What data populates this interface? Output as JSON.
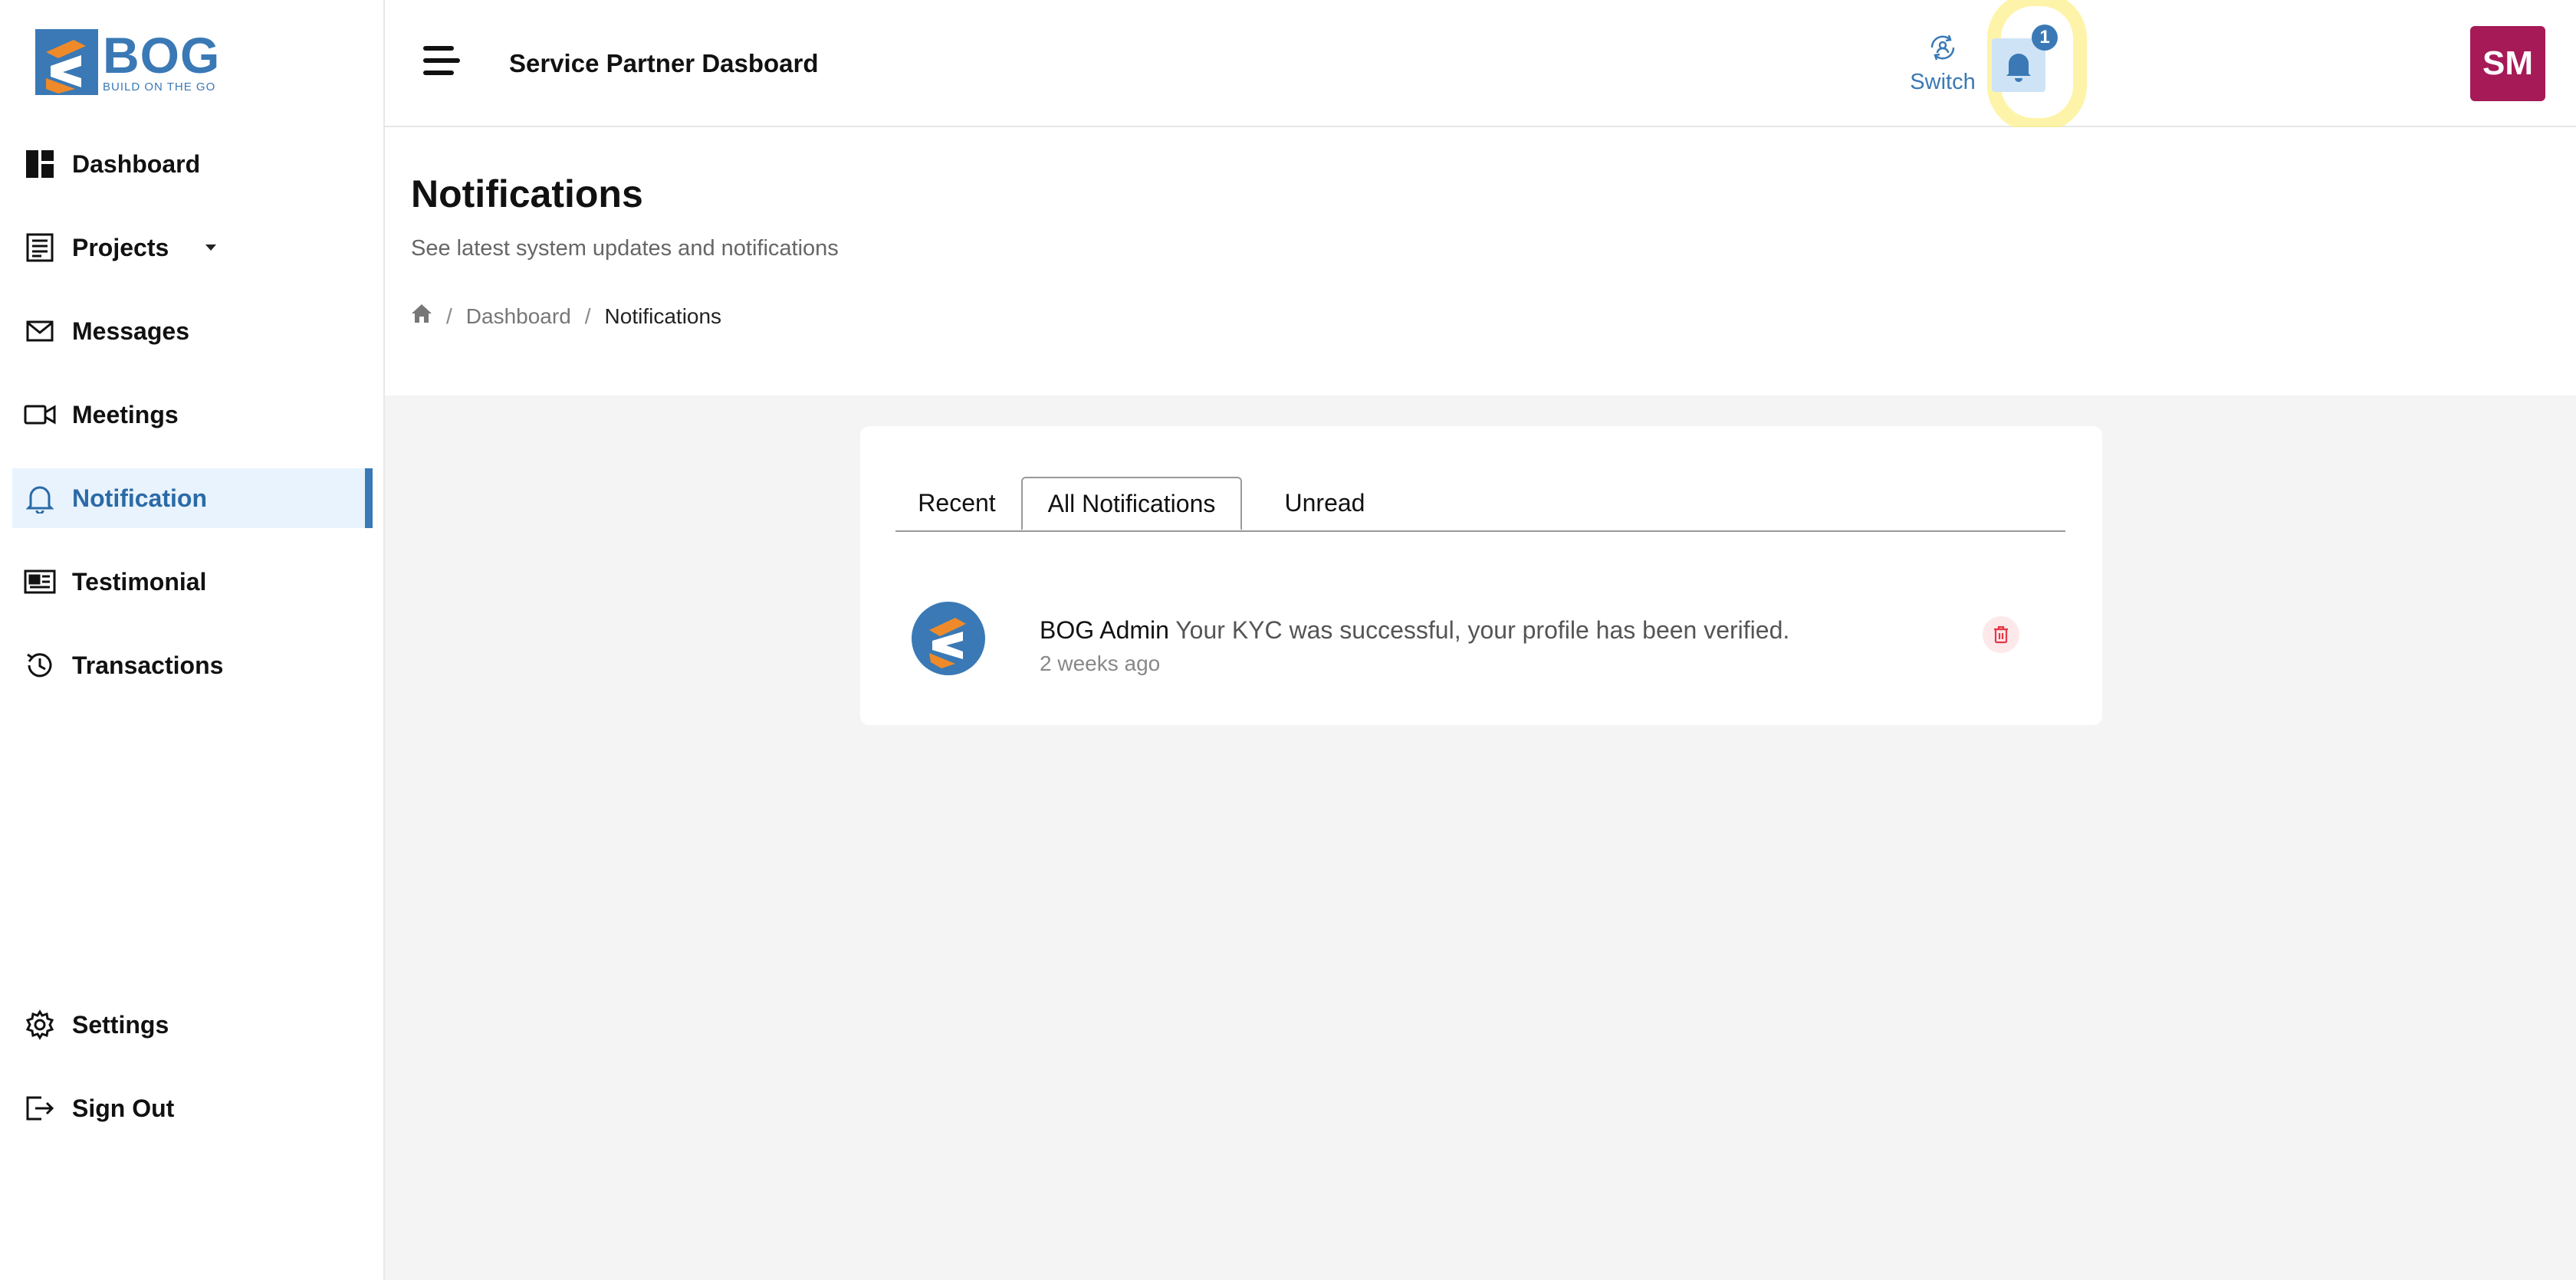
{
  "brand": {
    "name": "BOG",
    "tagline": "BUILD ON THE GO",
    "accent": "#3a79b5",
    "orange": "#ef8a2a"
  },
  "header": {
    "title": "Service Partner Dasboard",
    "switch_label": "Switch",
    "notification_count": "1",
    "avatar_initials": "SM",
    "avatar_color": "#a51a57"
  },
  "sidebar": {
    "items": [
      {
        "label": "Dashboard",
        "icon": "dashboard-icon"
      },
      {
        "label": "Projects",
        "icon": "document-list-icon",
        "has_dropdown": true
      },
      {
        "label": "Messages",
        "icon": "envelope-icon"
      },
      {
        "label": "Meetings",
        "icon": "video-camera-icon"
      },
      {
        "label": "Notification",
        "icon": "bell-icon",
        "active": true
      },
      {
        "label": "Testimonial",
        "icon": "newspaper-icon"
      },
      {
        "label": "Transactions",
        "icon": "history-icon"
      }
    ],
    "bottom": [
      {
        "label": "Settings",
        "icon": "gear-icon"
      },
      {
        "label": "Sign Out",
        "icon": "sign-out-icon"
      }
    ]
  },
  "page": {
    "title": "Notifications",
    "subtitle": "See latest system updates and notifications",
    "breadcrumb": {
      "home_icon": "home-icon",
      "items": [
        "Dashboard",
        "Notifications"
      ]
    }
  },
  "tabs": [
    {
      "label": "Recent"
    },
    {
      "label": "All Notifications",
      "active": true
    },
    {
      "label": "Unread"
    }
  ],
  "notifications": [
    {
      "sender": "BOG Admin",
      "message": "Your KYC was successful, your profile has been verified.",
      "time": "2 weeks ago"
    }
  ]
}
